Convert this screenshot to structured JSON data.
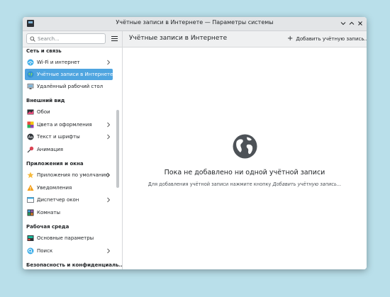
{
  "window": {
    "title": "Учётные записи в Интернете — Параметры системы"
  },
  "search": {
    "placeholder": "Search..."
  },
  "page": {
    "title": "Учётные записи в Интернете",
    "add_button": "Добавить учётную запись..."
  },
  "sidebar": {
    "sections": [
      {
        "title": "Сеть и связь",
        "items": [
          {
            "label": "Wi-Fi и интернет",
            "icon": "network-icon",
            "chevron": true
          },
          {
            "label": "Учётные записи в Интернете",
            "icon": "globe-icon",
            "chevron": false,
            "selected": true
          },
          {
            "label": "Удалённый рабочий стол",
            "icon": "remote-desktop-icon",
            "chevron": false
          }
        ]
      },
      {
        "title": "Внешний вид",
        "items": [
          {
            "label": "Обои",
            "icon": "wallpaper-icon",
            "chevron": false
          },
          {
            "label": "Цвета и оформления",
            "icon": "palette-icon",
            "chevron": true
          },
          {
            "label": "Текст и шрифты",
            "icon": "fonts-icon",
            "chevron": true
          },
          {
            "label": "Анимация",
            "icon": "animation-icon",
            "chevron": false
          }
        ]
      },
      {
        "title": "Приложения и окна",
        "items": [
          {
            "label": "Приложения по умолчанию",
            "icon": "star-icon",
            "chevron": true
          },
          {
            "label": "Уведомления",
            "icon": "bell-icon",
            "chevron": false
          },
          {
            "label": "Диспетчер окон",
            "icon": "window-manager-icon",
            "chevron": true
          },
          {
            "label": "Комнаты",
            "icon": "activities-icon",
            "chevron": false
          }
        ]
      },
      {
        "title": "Рабочая среда",
        "items": [
          {
            "label": "Основные параметры",
            "icon": "general-settings-icon",
            "chevron": false
          },
          {
            "label": "Поиск",
            "icon": "search-settings-icon",
            "chevron": true
          }
        ]
      },
      {
        "title": "Безопасность и конфиденциаль...",
        "items": []
      }
    ]
  },
  "empty_state": {
    "title": "Пока не добавлено ни одной учётной записи",
    "desc_prefix": "Для добавления учётной записи нажмите кнопку ",
    "desc_action": "Добавить учётную запись..."
  },
  "colors": {
    "accent": "#4fa5e0",
    "background": "#b9dfea"
  }
}
